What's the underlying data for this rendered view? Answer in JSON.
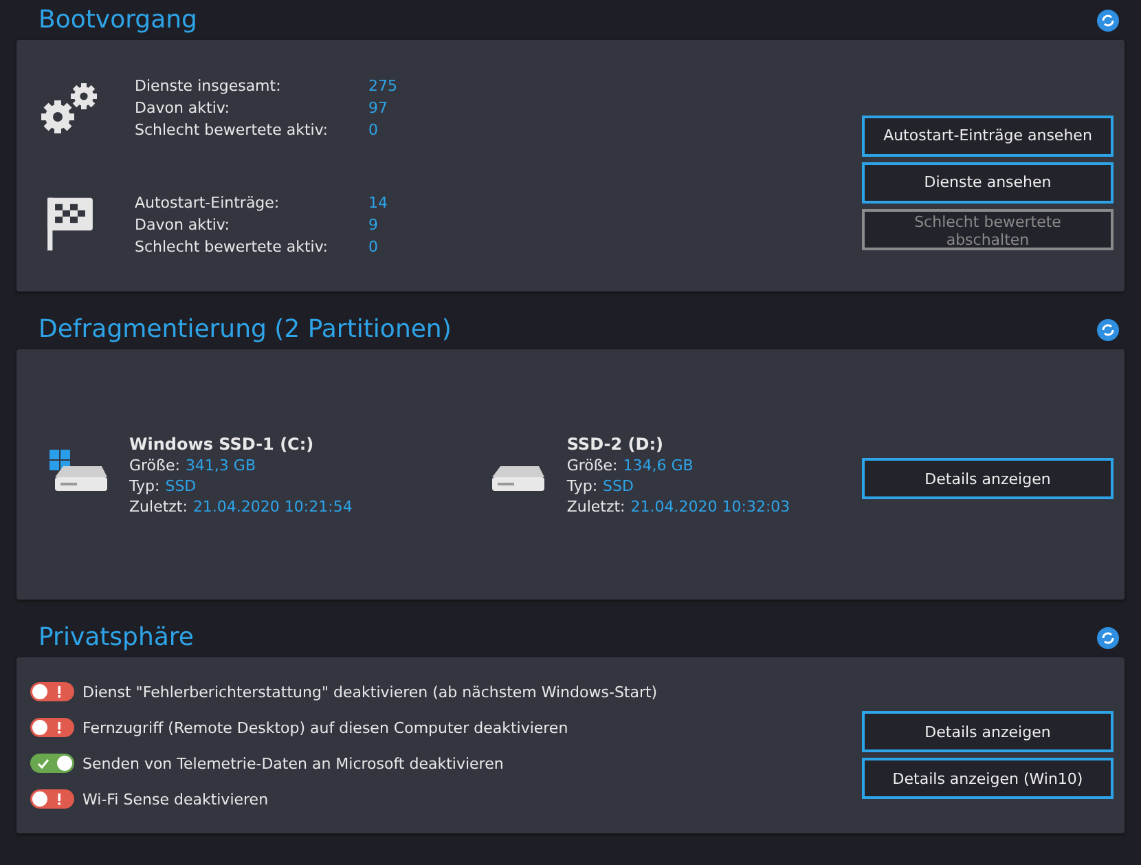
{
  "boot": {
    "title": "Bootvorgang",
    "groups": [
      {
        "kind": "gears",
        "rows": [
          {
            "label": "Dienste insgesamt:",
            "value": "275"
          },
          {
            "label": "Davon aktiv:",
            "value": "97"
          },
          {
            "label": "Schlecht bewertete aktiv:",
            "value": "0"
          }
        ]
      },
      {
        "kind": "flag",
        "rows": [
          {
            "label": "Autostart-Einträge:",
            "value": "14"
          },
          {
            "label": "Davon aktiv:",
            "value": "9"
          },
          {
            "label": "Schlecht bewertete aktiv:",
            "value": "0"
          }
        ]
      }
    ],
    "buttons": [
      {
        "label": "Autostart-Einträge ansehen",
        "disabled": false
      },
      {
        "label": "Dienste ansehen",
        "disabled": false
      },
      {
        "label": "Schlecht bewertete abschalten",
        "disabled": true
      }
    ]
  },
  "defrag": {
    "title": "Defragmentierung (2 Partitionen)",
    "drives": [
      {
        "name": "Windows SSD-1 (C:)",
        "system": true,
        "size_label": "Größe:",
        "size": "341,3 GB",
        "type_label": "Typ:",
        "type": "SSD",
        "last_label": "Zuletzt:",
        "last": "21.04.2020 10:21:54"
      },
      {
        "name": "SSD-2 (D:)",
        "system": false,
        "size_label": "Größe:",
        "size": "134,6 GB",
        "type_label": "Typ:",
        "type": "SSD",
        "last_label": "Zuletzt:",
        "last": "21.04.2020 10:32:03"
      }
    ],
    "buttons": [
      {
        "label": "Details anzeigen",
        "disabled": false
      }
    ]
  },
  "privacy": {
    "title": "Privatsphäre",
    "items": [
      {
        "label": "Dienst \"Fehlerberichterstattung\" deaktivieren (ab nächstem Windows-Start)",
        "on": false
      },
      {
        "label": "Fernzugriff (Remote Desktop) auf diesen Computer deaktivieren",
        "on": false
      },
      {
        "label": "Senden von Telemetrie-Daten an Microsoft deaktivieren",
        "on": true
      },
      {
        "label": "Wi-Fi Sense deaktivieren",
        "on": false
      }
    ],
    "buttons": [
      {
        "label": "Details anzeigen",
        "disabled": false
      },
      {
        "label": "Details anzeigen (Win10)",
        "disabled": false
      }
    ]
  }
}
